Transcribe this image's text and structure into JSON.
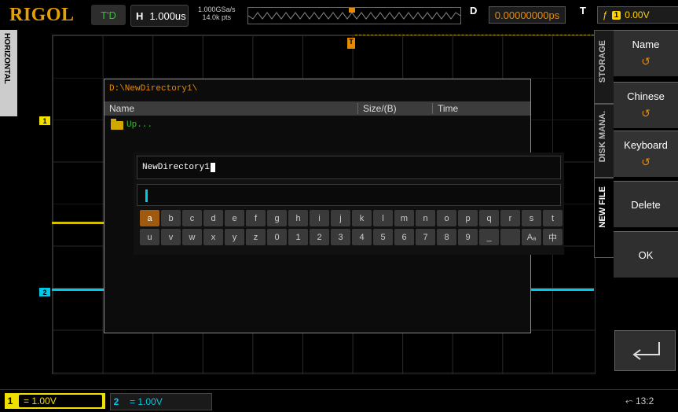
{
  "top": {
    "logo": "RIGOL",
    "trigger_status": "T'D",
    "horizontal_key": "H",
    "timebase": "1.000us",
    "sample_rate": "1.000GSa/s",
    "memory_depth": "14.0k pts",
    "delay_key": "D",
    "delay_value": "0.00000000ps",
    "trigger_key": "T",
    "trigger_slope": "ƒ",
    "trigger_source": "1",
    "trigger_level": "0.00V"
  },
  "left_tab": "HORIZONTAL",
  "channel_markers": {
    "ch1": "1",
    "ch2": "2"
  },
  "dialog": {
    "path": "D:\\NewDirectory1\\",
    "columns": [
      "Name",
      "Size/(B)",
      "Time"
    ],
    "up_entry": "Up...",
    "filename_value": "NewDirectory1",
    "input_value": ""
  },
  "keyboard": {
    "row1": [
      "a",
      "b",
      "c",
      "d",
      "e",
      "f",
      "g",
      "h",
      "i",
      "j",
      "k",
      "l",
      "m",
      "n",
      "o",
      "p",
      "q",
      "r",
      "s",
      "t"
    ],
    "row2": [
      "u",
      "v",
      "w",
      "x",
      "y",
      "z",
      "0",
      "1",
      "2",
      "3",
      "4",
      "5",
      "6",
      "7",
      "8",
      "9",
      "_",
      "",
      "Aₐ",
      "中"
    ],
    "selected": "a"
  },
  "side_tabs": [
    "STORAGE",
    "DISK MANA.",
    "NEW FILE"
  ],
  "active_tab": "NEW FILE",
  "softkeys": [
    {
      "label": "Name",
      "knob": "↺"
    },
    {
      "label": "Chinese",
      "knob": "↺"
    },
    {
      "label": "Keyboard",
      "knob": "↺"
    },
    {
      "label": "Delete",
      "knob": ""
    },
    {
      "label": "OK",
      "knob": ""
    }
  ],
  "bottom": {
    "ch1_num": "1",
    "ch1_scale": "= 1.00V",
    "ch2_num": "2",
    "ch2_scale": "= 1.00V",
    "time": "13:2"
  },
  "colors": {
    "ch1": "#f0e000",
    "ch2": "#00c8e8",
    "accent": "#e88a00"
  }
}
